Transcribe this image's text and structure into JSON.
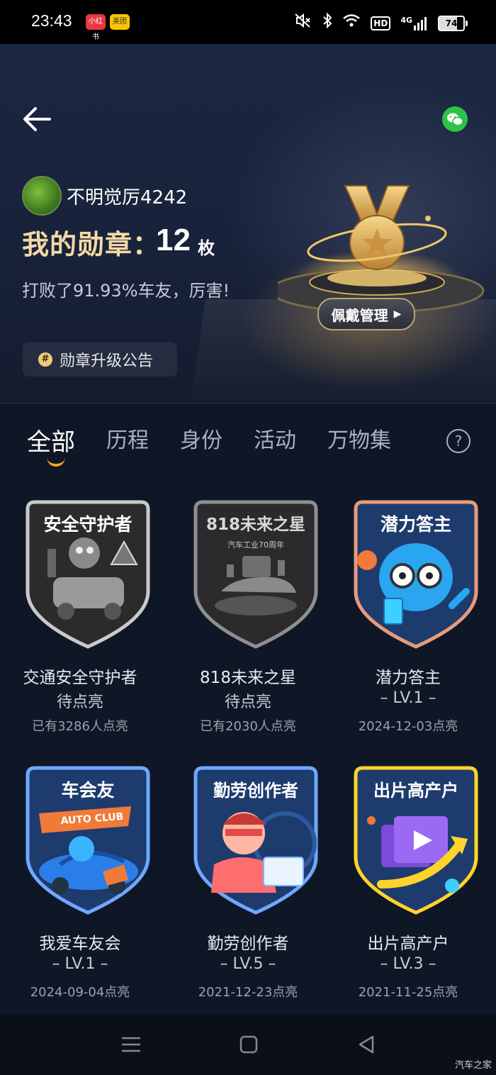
{
  "status_bar": {
    "time": "23:43",
    "app_badges": [
      "小红书",
      "美团"
    ],
    "hd": "HD",
    "network": "4G",
    "battery": "74",
    "battery_level": 0.74
  },
  "header": {
    "username": "不明觉厉4242",
    "medal_title": "我的勋章：",
    "medal_count": "12",
    "medal_unit": "枚",
    "beat_text": "打败了91.93%车友，厉害!",
    "wear_button": "佩戴管理",
    "notice_label": "勋章升级公告"
  },
  "tabs": [
    {
      "label": "全部",
      "active": true
    },
    {
      "label": "历程",
      "active": false
    },
    {
      "label": "身份",
      "active": false
    },
    {
      "label": "活动",
      "active": false
    },
    {
      "label": "万物集",
      "active": false
    }
  ],
  "help_icon": "?",
  "badges": [
    {
      "shield_title": "安全守护者",
      "name": "交通安全守护者",
      "status": "待点亮",
      "meta": "已有3286人点亮",
      "lit": false,
      "frame_color": "#bfbfbf"
    },
    {
      "shield_title": "818未来之星",
      "subtitle": "汽车工业70周年",
      "name": "818未来之星",
      "status": "待点亮",
      "meta": "已有2030人点亮",
      "lit": false,
      "frame_color": "#8f8f8f"
    },
    {
      "shield_title": "潜力答主",
      "name": "潜力答主",
      "status": "– LV.1 –",
      "meta": "2024-12-03点亮",
      "lit": true,
      "frame_color": "#e89a7c"
    },
    {
      "shield_title": "车会友",
      "banner_text": "AUTO CLUB",
      "name": "我爱车友会",
      "status": "– LV.1 –",
      "meta": "2024-09-04点亮",
      "lit": true,
      "frame_color": "#6fa8ff"
    },
    {
      "shield_title": "勤劳创作者",
      "name": "勤劳创作者",
      "status": "– LV.5 –",
      "meta": "2021-12-23点亮",
      "lit": true,
      "frame_color": "#6fa8ff"
    },
    {
      "shield_title": "出片高产户",
      "name": "出片高产户",
      "status": "– LV.3 –",
      "meta": "2021-11-25点亮",
      "lit": true,
      "frame_color": "#ffd42a"
    }
  ],
  "watermark": "汽车之家"
}
